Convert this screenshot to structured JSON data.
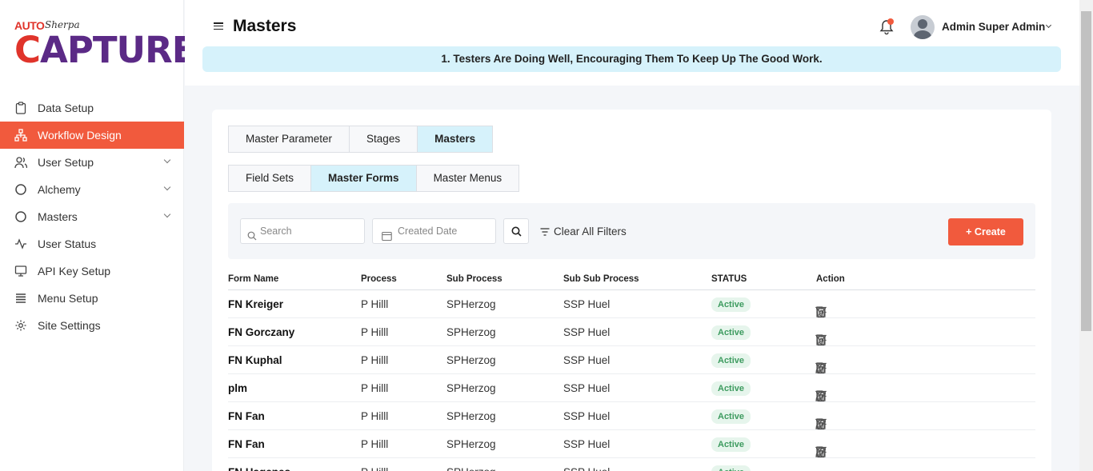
{
  "logo": {
    "auto": "AUTO",
    "sherpa": "Sherpa",
    "capture_c": "C",
    "capture_rest": "APTURE"
  },
  "sidebar": {
    "items": [
      {
        "label": "Data Setup",
        "icon": "clipboard-icon"
      },
      {
        "label": "Workflow Design",
        "icon": "hierarchy-icon"
      },
      {
        "label": "User Setup",
        "icon": "users-icon"
      },
      {
        "label": "Alchemy",
        "icon": "circle-icon"
      },
      {
        "label": "Masters",
        "icon": "circle-icon"
      },
      {
        "label": "User Status",
        "icon": "activity-icon"
      },
      {
        "label": "API Key Setup",
        "icon": "monitor-icon"
      },
      {
        "label": "Menu Setup",
        "icon": "list-icon"
      },
      {
        "label": "Site Settings",
        "icon": "gear-icon"
      }
    ]
  },
  "header": {
    "title": "Masters",
    "user_name": "Admin Super Admin",
    "announcement": "1. Testers Are Doing Well, Encouraging Them To Keep Up The Good Work."
  },
  "tabs_primary": [
    "Master Parameter",
    "Stages",
    "Masters"
  ],
  "tabs_secondary": [
    "Field Sets",
    "Master Forms",
    "Master Menus"
  ],
  "filters": {
    "search_placeholder": "Search",
    "date_placeholder": "Created Date",
    "clear_label": "Clear All Filters",
    "create_label": "+ Create"
  },
  "table": {
    "headers": [
      "Form Name",
      "Process",
      "Sub Process",
      "Sub Sub Process",
      "STATUS",
      "Action"
    ],
    "rows": [
      {
        "name": "FN Kreiger",
        "process": "P Hilll",
        "sub": "SPHerzog",
        "subsub": "SSP Huel",
        "status": "Active"
      },
      {
        "name": "FN Gorczany",
        "process": "P Hilll",
        "sub": "SPHerzog",
        "subsub": "SSP Huel",
        "status": "Active"
      },
      {
        "name": "FN Kuphal",
        "process": "P Hilll",
        "sub": "SPHerzog",
        "subsub": "SSP Huel",
        "status": "Active"
      },
      {
        "name": "plm",
        "process": "P Hilll",
        "sub": "SPHerzog",
        "subsub": "SSP Huel",
        "status": "Active"
      },
      {
        "name": "FN Fan",
        "process": "P Hilll",
        "sub": "SPHerzog",
        "subsub": "SSP Huel",
        "status": "Active"
      },
      {
        "name": "FN Fan",
        "process": "P Hilll",
        "sub": "SPHerzog",
        "subsub": "SSP Huel",
        "status": "Active"
      },
      {
        "name": "FN Hagenes",
        "process": "P Hilll",
        "sub": "SPHerzog",
        "subsub": "SSP Huel",
        "status": "Active"
      }
    ]
  },
  "colors": {
    "accent": "#f15a3d",
    "tab_selected": "#d6f2fb",
    "active_badge": "#3d9b5f"
  }
}
